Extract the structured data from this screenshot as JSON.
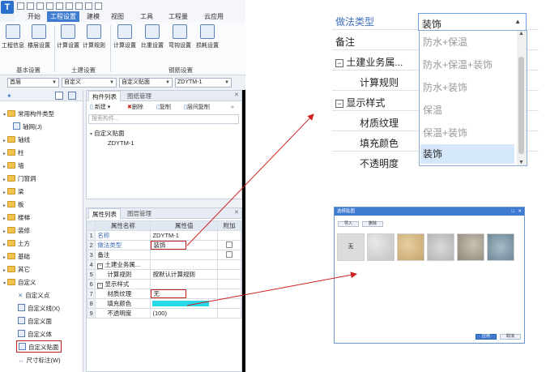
{
  "menu": {
    "tabs": [
      "开始",
      "工程设置",
      "建模",
      "视图",
      "工具",
      "工程量",
      "云应用"
    ],
    "active": "工程设置"
  },
  "ribbon": {
    "groups": [
      {
        "label": "基本设置",
        "buttons": [
          "工程信息",
          "楼层设置"
        ]
      },
      {
        "label": "土建设置",
        "buttons": [
          "计算设置",
          "计算规则"
        ]
      },
      {
        "label": "钢筋设置",
        "buttons": [
          "计算设置",
          "比重设置",
          "弯钩设置",
          "损耗设置"
        ]
      }
    ]
  },
  "combos": [
    "首层",
    "自定义",
    "自定义贴面",
    "ZDYTM-1"
  ],
  "nav": {
    "items": [
      {
        "label": "常用构件类型",
        "level": 0
      },
      {
        "label": "轴网(J)",
        "level": 1
      },
      {
        "label": "轴线",
        "level": 0
      },
      {
        "label": "柱",
        "level": 0
      },
      {
        "label": "墙",
        "level": 0
      },
      {
        "label": "门窗洞",
        "level": 0
      },
      {
        "label": "梁",
        "level": 0
      },
      {
        "label": "板",
        "level": 0
      },
      {
        "label": "楼梯",
        "level": 0
      },
      {
        "label": "装修",
        "level": 0
      },
      {
        "label": "土方",
        "level": 0
      },
      {
        "label": "基础",
        "level": 0
      },
      {
        "label": "其它",
        "level": 0
      },
      {
        "label": "自定义",
        "level": 0
      },
      {
        "label": "自定义点",
        "level": 1
      },
      {
        "label": "自定义线(X)",
        "level": 1
      },
      {
        "label": "自定义面",
        "level": 1
      },
      {
        "label": "自定义体",
        "level": 1
      },
      {
        "label": "自定义贴面",
        "level": 1
      },
      {
        "label": "尺寸标注(W)",
        "level": 1
      }
    ],
    "selected": "自定义贴面"
  },
  "component_list": {
    "tabs": [
      "构件列表",
      "图纸管理"
    ],
    "toolbar": [
      "新建",
      "删除",
      "复制",
      "层间复制"
    ],
    "search_placeholder": "搜索构件...",
    "tree_root": "自定义贴面",
    "tree_child": "ZDYTM-1"
  },
  "properties": {
    "tabs": [
      "属性列表",
      "图层管理"
    ],
    "headers": [
      "属性名称",
      "属性值",
      "附加"
    ],
    "rows": [
      {
        "num": "1",
        "name": "名称",
        "value": "ZDYTM-1",
        "check": false
      },
      {
        "num": "2",
        "name": "做法类型",
        "value": "装饰",
        "check": true
      },
      {
        "num": "3",
        "name": "备注",
        "value": "",
        "check": true
      },
      {
        "num": "4",
        "name": "土建业务属...",
        "value": "",
        "check": false,
        "group": true
      },
      {
        "num": "5",
        "name": "计算规则",
        "value": "按默认计算规则",
        "check": false
      },
      {
        "num": "6",
        "name": "显示样式",
        "value": "",
        "check": false,
        "group": true
      },
      {
        "num": "7",
        "name": "材质纹理",
        "value": "无",
        "check": false
      },
      {
        "num": "8",
        "name": "填充颜色",
        "value": "",
        "check": false
      },
      {
        "num": "9",
        "name": "不透明度",
        "value": "(100)",
        "check": false
      }
    ],
    "fill_color": "#27d8e8"
  },
  "zoom": {
    "rows": [
      {
        "label": "做法类型",
        "link": true
      },
      {
        "label": "备注"
      },
      {
        "label": "土建业务属...",
        "group": true
      },
      {
        "label": "计算规则"
      },
      {
        "label": "显示样式",
        "group": true
      },
      {
        "label": "材质纹理"
      },
      {
        "label": "填充颜色"
      },
      {
        "label": "不透明度"
      }
    ],
    "dropdown_value": "装饰",
    "options": [
      "防水+保温",
      "防水+保温+装饰",
      "防水+装饰",
      "保温",
      "保温+装饰",
      "装饰"
    ],
    "selected_option": "装饰"
  },
  "dialog": {
    "title": "选择贴图",
    "buttons": [
      "导入",
      "删除"
    ],
    "none_tile": "无",
    "ok": "应用",
    "cancel": "取消"
  },
  "colors": {
    "accent": "#3f7cd1",
    "highlight": "#c0221b",
    "arrow": "#d01f1f"
  }
}
